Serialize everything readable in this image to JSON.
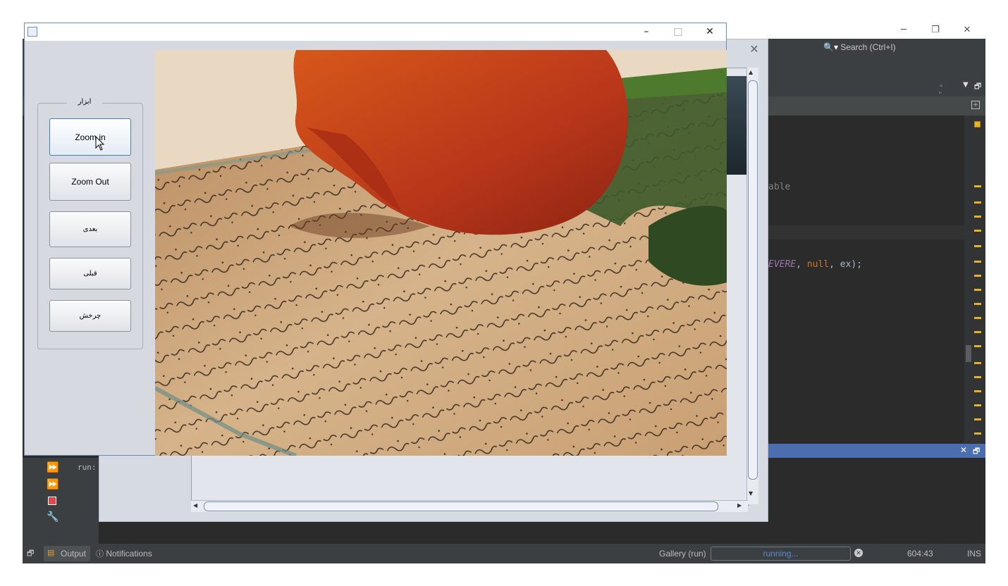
{
  "ide": {
    "search_placeholder": "Search (Ctrl+I)",
    "code_lines": [
      {
        "text": "able"
      },
      {
        "keyword": "EVERE",
        "sep1": ", ",
        "null_kw": "null",
        "rest": ", ex);"
      }
    ],
    "output_text": "run:",
    "statusbar": {
      "output_tab": "Output",
      "notifications_tab": "Notifications",
      "task_label": "Gallery (run)",
      "progress_text": "running...",
      "caret_position": "604:43",
      "insert_mode": "INS"
    }
  },
  "viewer": {
    "title": "",
    "tools_group_title": "ابزار",
    "buttons": {
      "zoom_in": "Zoom in",
      "zoom_out": "Zoom Out",
      "next": "بعدی",
      "previous": "قبلی",
      "rotate": "چرخش"
    },
    "window_controls": {
      "minimize": "–",
      "maximize": "□",
      "close": "✕"
    }
  },
  "colors": {
    "accent_blue": "#4b6eaf",
    "marker_yellow": "#e6b422",
    "keyword_purple": "#9876aa",
    "null_orange": "#cc7832"
  }
}
